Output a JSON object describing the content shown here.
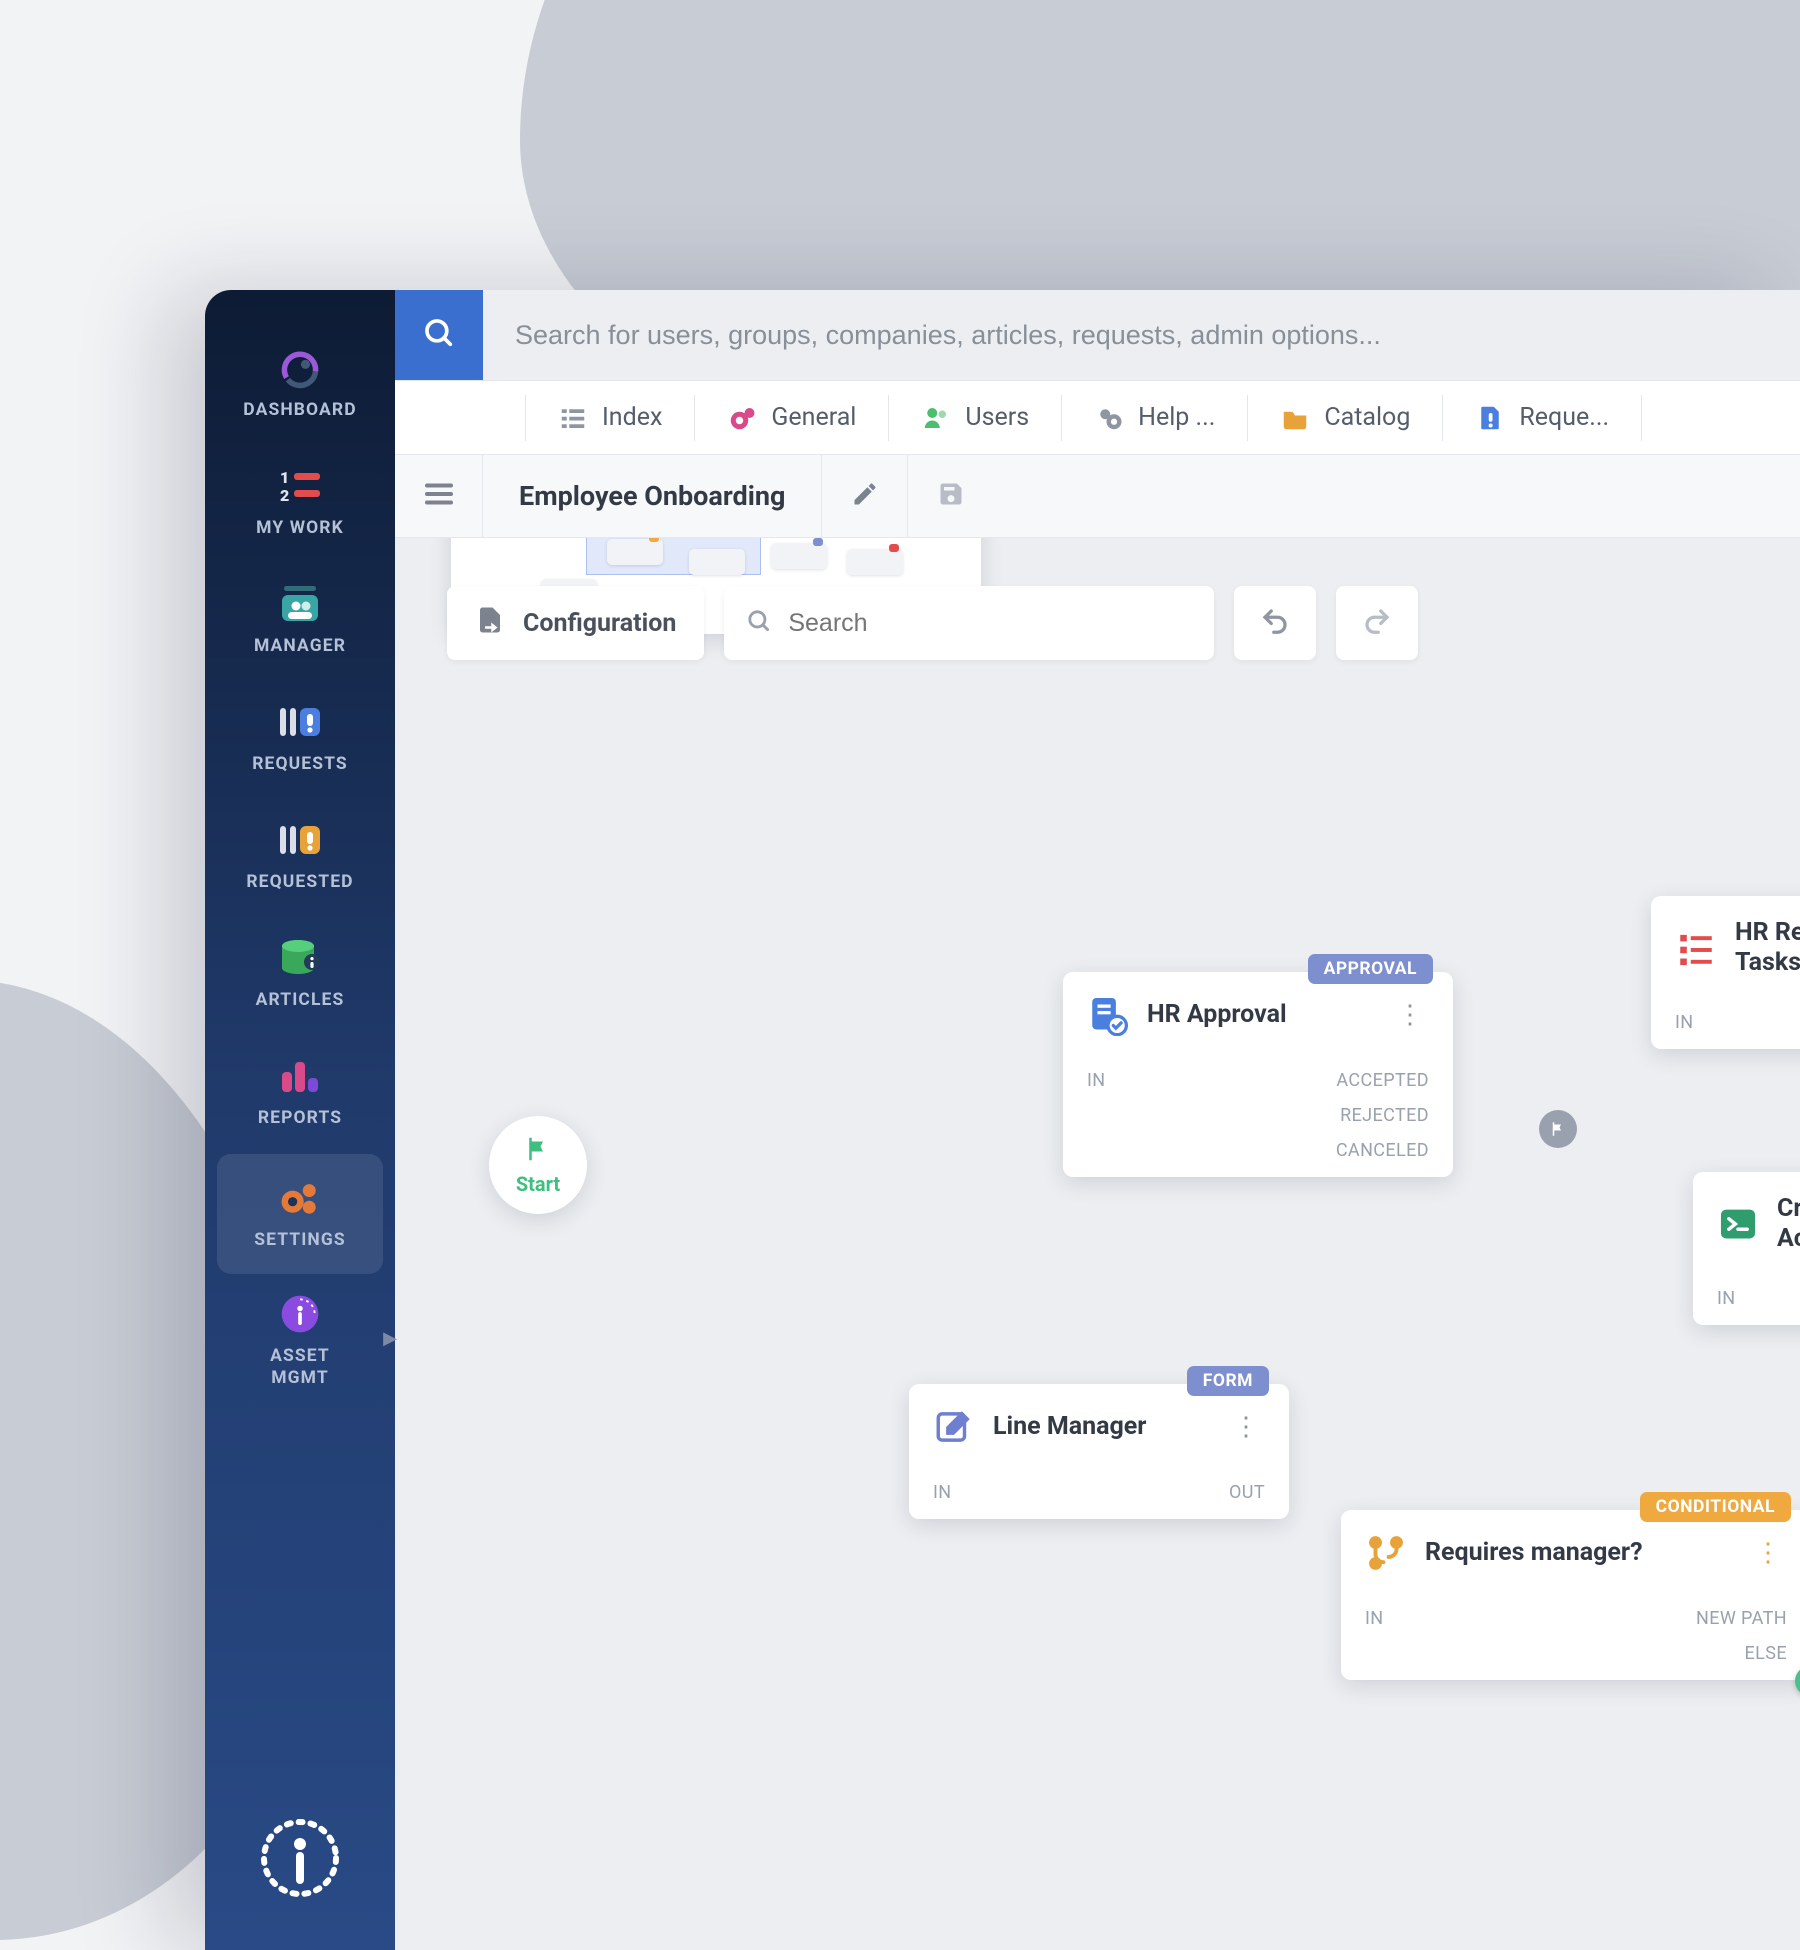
{
  "sidebar": {
    "items": [
      {
        "label": "DASHBOARD"
      },
      {
        "label": "MY WORK"
      },
      {
        "label": "MANAGER"
      },
      {
        "label": "REQUESTS"
      },
      {
        "label": "REQUESTED"
      },
      {
        "label": "ARTICLES"
      },
      {
        "label": "REPORTS"
      },
      {
        "label": "SETTINGS"
      },
      {
        "label_line1": "ASSET",
        "label_line2": "MGMT"
      }
    ]
  },
  "topbar": {
    "search_placeholder": "Search for users, groups, companies, articles, requests, admin options..."
  },
  "tabs": [
    {
      "label": "Index"
    },
    {
      "label": "General"
    },
    {
      "label": "Users"
    },
    {
      "label": "Help ..."
    },
    {
      "label": "Catalog"
    },
    {
      "label": "Reque..."
    }
  ],
  "page": {
    "title": "Employee Onboarding",
    "config_label": "Configuration",
    "search_placeholder": "Search"
  },
  "ports": {
    "in": "IN",
    "out": "OUT",
    "accepted": "ACCEPTED",
    "rejected": "REJECTED",
    "canceled": "CANCELED",
    "new_path": "NEW PATH",
    "else": "ELSE"
  },
  "badges": {
    "approval": "APPROVAL",
    "form": "FORM",
    "conditional": "CONDITIONAL"
  },
  "nodes": {
    "start": "Start",
    "hr_approval": "HR Approval",
    "line_manager": "Line Manager",
    "hr_tasks_line1": "HR Registration",
    "hr_tasks_line2": "Tasks",
    "create_azure_line1": "Create Azure",
    "create_azure_line2": "Account",
    "requires_manager": "Requires manager?"
  },
  "colors": {
    "accent_blue": "#3a6fcf",
    "approval_badge": "#7d8fcf",
    "conditional_badge": "#f0a93e",
    "else_badge": "#e24c4c",
    "start_green": "#3fbf7e"
  }
}
